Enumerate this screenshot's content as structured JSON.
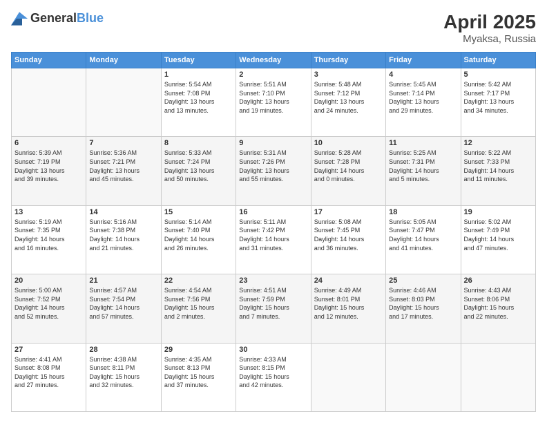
{
  "logo": {
    "general": "General",
    "blue": "Blue"
  },
  "header": {
    "month": "April 2025",
    "location": "Myaksa, Russia"
  },
  "weekdays": [
    "Sunday",
    "Monday",
    "Tuesday",
    "Wednesday",
    "Thursday",
    "Friday",
    "Saturday"
  ],
  "weeks": [
    [
      {
        "day": "",
        "info": ""
      },
      {
        "day": "",
        "info": ""
      },
      {
        "day": "1",
        "info": "Sunrise: 5:54 AM\nSunset: 7:08 PM\nDaylight: 13 hours\nand 13 minutes."
      },
      {
        "day": "2",
        "info": "Sunrise: 5:51 AM\nSunset: 7:10 PM\nDaylight: 13 hours\nand 19 minutes."
      },
      {
        "day": "3",
        "info": "Sunrise: 5:48 AM\nSunset: 7:12 PM\nDaylight: 13 hours\nand 24 minutes."
      },
      {
        "day": "4",
        "info": "Sunrise: 5:45 AM\nSunset: 7:14 PM\nDaylight: 13 hours\nand 29 minutes."
      },
      {
        "day": "5",
        "info": "Sunrise: 5:42 AM\nSunset: 7:17 PM\nDaylight: 13 hours\nand 34 minutes."
      }
    ],
    [
      {
        "day": "6",
        "info": "Sunrise: 5:39 AM\nSunset: 7:19 PM\nDaylight: 13 hours\nand 39 minutes."
      },
      {
        "day": "7",
        "info": "Sunrise: 5:36 AM\nSunset: 7:21 PM\nDaylight: 13 hours\nand 45 minutes."
      },
      {
        "day": "8",
        "info": "Sunrise: 5:33 AM\nSunset: 7:24 PM\nDaylight: 13 hours\nand 50 minutes."
      },
      {
        "day": "9",
        "info": "Sunrise: 5:31 AM\nSunset: 7:26 PM\nDaylight: 13 hours\nand 55 minutes."
      },
      {
        "day": "10",
        "info": "Sunrise: 5:28 AM\nSunset: 7:28 PM\nDaylight: 14 hours\nand 0 minutes."
      },
      {
        "day": "11",
        "info": "Sunrise: 5:25 AM\nSunset: 7:31 PM\nDaylight: 14 hours\nand 5 minutes."
      },
      {
        "day": "12",
        "info": "Sunrise: 5:22 AM\nSunset: 7:33 PM\nDaylight: 14 hours\nand 11 minutes."
      }
    ],
    [
      {
        "day": "13",
        "info": "Sunrise: 5:19 AM\nSunset: 7:35 PM\nDaylight: 14 hours\nand 16 minutes."
      },
      {
        "day": "14",
        "info": "Sunrise: 5:16 AM\nSunset: 7:38 PM\nDaylight: 14 hours\nand 21 minutes."
      },
      {
        "day": "15",
        "info": "Sunrise: 5:14 AM\nSunset: 7:40 PM\nDaylight: 14 hours\nand 26 minutes."
      },
      {
        "day": "16",
        "info": "Sunrise: 5:11 AM\nSunset: 7:42 PM\nDaylight: 14 hours\nand 31 minutes."
      },
      {
        "day": "17",
        "info": "Sunrise: 5:08 AM\nSunset: 7:45 PM\nDaylight: 14 hours\nand 36 minutes."
      },
      {
        "day": "18",
        "info": "Sunrise: 5:05 AM\nSunset: 7:47 PM\nDaylight: 14 hours\nand 41 minutes."
      },
      {
        "day": "19",
        "info": "Sunrise: 5:02 AM\nSunset: 7:49 PM\nDaylight: 14 hours\nand 47 minutes."
      }
    ],
    [
      {
        "day": "20",
        "info": "Sunrise: 5:00 AM\nSunset: 7:52 PM\nDaylight: 14 hours\nand 52 minutes."
      },
      {
        "day": "21",
        "info": "Sunrise: 4:57 AM\nSunset: 7:54 PM\nDaylight: 14 hours\nand 57 minutes."
      },
      {
        "day": "22",
        "info": "Sunrise: 4:54 AM\nSunset: 7:56 PM\nDaylight: 15 hours\nand 2 minutes."
      },
      {
        "day": "23",
        "info": "Sunrise: 4:51 AM\nSunset: 7:59 PM\nDaylight: 15 hours\nand 7 minutes."
      },
      {
        "day": "24",
        "info": "Sunrise: 4:49 AM\nSunset: 8:01 PM\nDaylight: 15 hours\nand 12 minutes."
      },
      {
        "day": "25",
        "info": "Sunrise: 4:46 AM\nSunset: 8:03 PM\nDaylight: 15 hours\nand 17 minutes."
      },
      {
        "day": "26",
        "info": "Sunrise: 4:43 AM\nSunset: 8:06 PM\nDaylight: 15 hours\nand 22 minutes."
      }
    ],
    [
      {
        "day": "27",
        "info": "Sunrise: 4:41 AM\nSunset: 8:08 PM\nDaylight: 15 hours\nand 27 minutes."
      },
      {
        "day": "28",
        "info": "Sunrise: 4:38 AM\nSunset: 8:11 PM\nDaylight: 15 hours\nand 32 minutes."
      },
      {
        "day": "29",
        "info": "Sunrise: 4:35 AM\nSunset: 8:13 PM\nDaylight: 15 hours\nand 37 minutes."
      },
      {
        "day": "30",
        "info": "Sunrise: 4:33 AM\nSunset: 8:15 PM\nDaylight: 15 hours\nand 42 minutes."
      },
      {
        "day": "",
        "info": ""
      },
      {
        "day": "",
        "info": ""
      },
      {
        "day": "",
        "info": ""
      }
    ]
  ]
}
